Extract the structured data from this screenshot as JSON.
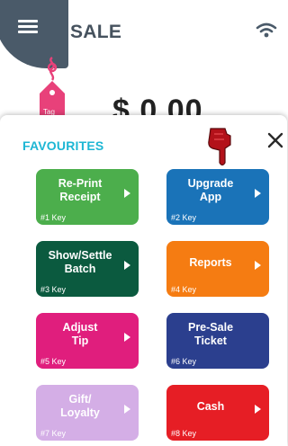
{
  "header": {
    "title": "SALE",
    "menu_icon": "hamburger-menu-icon",
    "wifi_icon": "wifi-icon"
  },
  "sale": {
    "tag_label": "Tag",
    "amount": "$ 0.00"
  },
  "favourites": {
    "title": "FAVOURITES",
    "close_icon": "close-icon",
    "pointer_icon": "pointing-hand-icon",
    "tiles": [
      {
        "label": "Re-Print\nReceipt",
        "key": "#1 Key",
        "color": "#4cae4c"
      },
      {
        "label": "Upgrade\nApp",
        "key": "#2 Key",
        "color": "#1a73b8"
      },
      {
        "label": "Show/Settle\nBatch",
        "key": "#3 Key",
        "color": "#0b5a3f"
      },
      {
        "label": "Reports",
        "key": "#4 Key",
        "color": "#f57c12"
      },
      {
        "label": "Adjust\nTip",
        "key": "#5 Key",
        "color": "#e01e7d"
      },
      {
        "label": "Pre-Sale\nTicket",
        "key": "#6 Key",
        "color": "#2b3f8e"
      },
      {
        "label": "Gift/\nLoyalty",
        "key": "#7 Key",
        "color": "#d4aee6"
      },
      {
        "label": "Cash",
        "key": "#8 Key",
        "color": "#e61e25"
      }
    ]
  },
  "colors": {
    "header_text": "#46525e",
    "menu_blob": "#4a5a69",
    "accent": "#1db6d4",
    "tag": "#e8417a"
  }
}
